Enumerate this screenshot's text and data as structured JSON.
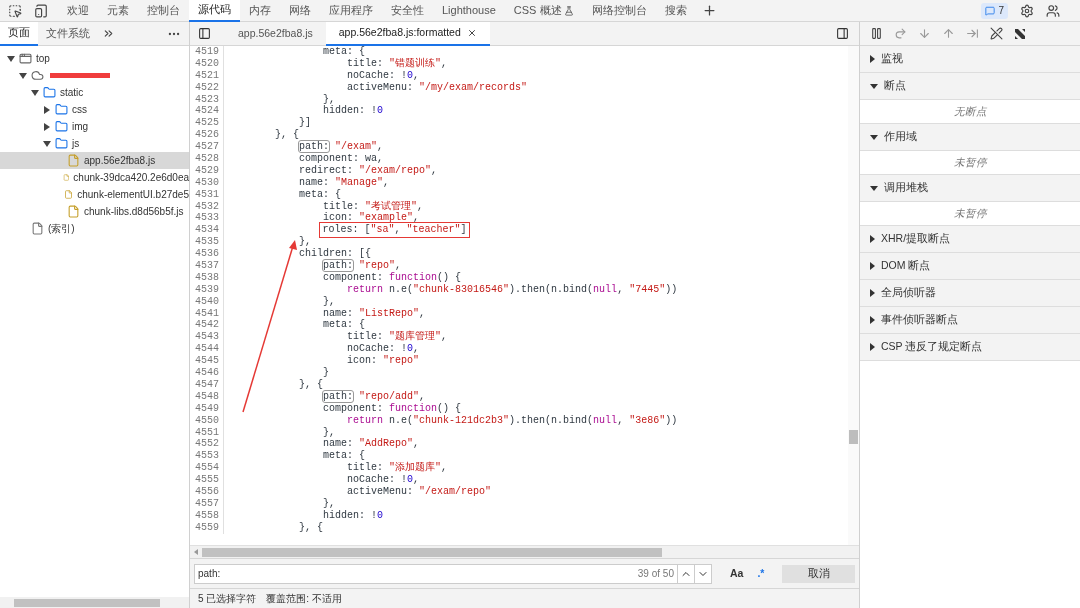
{
  "main_tabs": [
    {
      "label": "欢迎",
      "selected": false
    },
    {
      "label": "元素",
      "selected": false
    },
    {
      "label": "控制台",
      "selected": false
    },
    {
      "label": "源代码",
      "selected": true
    },
    {
      "label": "内存",
      "selected": false
    },
    {
      "label": "网络",
      "selected": false
    },
    {
      "label": "应用程序",
      "selected": false
    },
    {
      "label": "安全性",
      "selected": false
    },
    {
      "label": "Lighthouse",
      "selected": false
    },
    {
      "label": "CSS 概述",
      "selected": false,
      "flask": true
    },
    {
      "label": "网络控制台",
      "selected": false
    },
    {
      "label": "搜索",
      "selected": false
    }
  ],
  "issues_badge": "7",
  "navigator": {
    "tabs": [
      {
        "label": "页面",
        "selected": true
      },
      {
        "label": "文件系统",
        "selected": false
      }
    ],
    "tree": [
      {
        "kind": "frame",
        "label": "top",
        "expanded": true,
        "children": [
          {
            "kind": "domain",
            "expanded": true,
            "children": [
              {
                "kind": "folder",
                "label": "static",
                "expanded": true,
                "children": [
                  {
                    "kind": "folder",
                    "label": "css",
                    "expanded": false
                  },
                  {
                    "kind": "folder",
                    "label": "img",
                    "expanded": false
                  },
                  {
                    "kind": "folder",
                    "label": "js",
                    "expanded": true,
                    "children": [
                      {
                        "kind": "file",
                        "label": "app.56e2fba8.js",
                        "selected": true
                      },
                      {
                        "kind": "file",
                        "label": "chunk-39dca420.2e6d0ea",
                        "selected": false
                      },
                      {
                        "kind": "file",
                        "label": "chunk-elementUI.b27de5",
                        "selected": false
                      },
                      {
                        "kind": "file",
                        "label": "chunk-libs.d8d56b5f.js",
                        "selected": false
                      }
                    ]
                  }
                ]
              }
            ]
          },
          {
            "kind": "index",
            "label": "(索引)"
          }
        ]
      }
    ]
  },
  "editor_tabs": [
    {
      "label": "app.56e2fba8.js",
      "selected": false,
      "closable": false
    },
    {
      "label": "app.56e2fba8.js:formatted",
      "selected": true,
      "closable": true
    }
  ],
  "code_lines": [
    {
      "number": "4519",
      "tokens": [
        {
          "kind": "plain",
          "text": "                meta: {"
        }
      ]
    },
    {
      "number": "4520",
      "tokens": [
        {
          "kind": "plain",
          "text": "                    title: "
        },
        {
          "kind": "string",
          "text": "\"错题训练\""
        },
        {
          "kind": "plain",
          "text": ","
        }
      ]
    },
    {
      "number": "4521",
      "tokens": [
        {
          "kind": "plain",
          "text": "                    noCache: !"
        },
        {
          "kind": "number",
          "text": "0"
        },
        {
          "kind": "plain",
          "text": ","
        }
      ]
    },
    {
      "number": "4522",
      "tokens": [
        {
          "kind": "plain",
          "text": "                    activeMenu: "
        },
        {
          "kind": "string",
          "text": "\"/my/exam/records\""
        }
      ]
    },
    {
      "number": "4523",
      "tokens": [
        {
          "kind": "plain",
          "text": "                },"
        }
      ]
    },
    {
      "number": "4524",
      "tokens": [
        {
          "kind": "plain",
          "text": "                hidden: !"
        },
        {
          "kind": "number",
          "text": "0"
        }
      ]
    },
    {
      "number": "4525",
      "tokens": [
        {
          "kind": "plain",
          "text": "            }]"
        }
      ]
    },
    {
      "number": "4526",
      "tokens": [
        {
          "kind": "plain",
          "text": "        }, {"
        }
      ]
    },
    {
      "number": "4527",
      "tokens": [
        {
          "kind": "match",
          "text": "            path: "
        },
        {
          "kind": "string",
          "text": "\"/exam\""
        },
        {
          "kind": "plain",
          "text": ","
        }
      ]
    },
    {
      "number": "4528",
      "tokens": [
        {
          "kind": "plain",
          "text": "            component: wa,"
        }
      ]
    },
    {
      "number": "4529",
      "tokens": [
        {
          "kind": "plain",
          "text": "            redirect: "
        },
        {
          "kind": "string",
          "text": "\"/exam/repo\""
        },
        {
          "kind": "plain",
          "text": ","
        }
      ]
    },
    {
      "number": "4530",
      "tokens": [
        {
          "kind": "plain",
          "text": "            name: "
        },
        {
          "kind": "string",
          "text": "\"Manage\""
        },
        {
          "kind": "plain",
          "text": ","
        }
      ]
    },
    {
      "number": "4531",
      "tokens": [
        {
          "kind": "plain",
          "text": "            meta: {"
        }
      ]
    },
    {
      "number": "4532",
      "tokens": [
        {
          "kind": "plain",
          "text": "                title: "
        },
        {
          "kind": "string",
          "text": "\"考试管理\""
        },
        {
          "kind": "plain",
          "text": ","
        }
      ]
    },
    {
      "number": "4533",
      "tokens": [
        {
          "kind": "plain",
          "text": "                icon: "
        },
        {
          "kind": "string",
          "text": "\"example\""
        },
        {
          "kind": "plain",
          "text": ","
        }
      ]
    },
    {
      "number": "4534",
      "annotated": true,
      "tokens": [
        {
          "kind": "plain",
          "text": "                roles: ["
        },
        {
          "kind": "string",
          "text": "\"sa\""
        },
        {
          "kind": "plain",
          "text": ", "
        },
        {
          "kind": "string",
          "text": "\"teacher\""
        },
        {
          "kind": "plain",
          "text": "]"
        }
      ]
    },
    {
      "number": "4535",
      "tokens": [
        {
          "kind": "plain",
          "text": "            },"
        }
      ]
    },
    {
      "number": "4536",
      "tokens": [
        {
          "kind": "plain",
          "text": "            children: [{"
        }
      ]
    },
    {
      "number": "4537",
      "tokens": [
        {
          "kind": "match",
          "text": "                path: "
        },
        {
          "kind": "string",
          "text": "\"repo\""
        },
        {
          "kind": "plain",
          "text": ","
        }
      ]
    },
    {
      "number": "4538",
      "tokens": [
        {
          "kind": "plain",
          "text": "                component: "
        },
        {
          "kind": "keyword",
          "text": "function"
        },
        {
          "kind": "plain",
          "text": "() {"
        }
      ]
    },
    {
      "number": "4539",
      "tokens": [
        {
          "kind": "keyword",
          "text": "                    return"
        },
        {
          "kind": "plain",
          "text": " n.e("
        },
        {
          "kind": "string",
          "text": "\"chunk-83016546\""
        },
        {
          "kind": "plain",
          "text": ").then(n.bind("
        },
        {
          "kind": "keyword",
          "text": "null"
        },
        {
          "kind": "plain",
          "text": ", "
        },
        {
          "kind": "string",
          "text": "\"7445\""
        },
        {
          "kind": "plain",
          "text": "))"
        }
      ]
    },
    {
      "number": "4540",
      "tokens": [
        {
          "kind": "plain",
          "text": "                },"
        }
      ]
    },
    {
      "number": "4541",
      "tokens": [
        {
          "kind": "plain",
          "text": "                name: "
        },
        {
          "kind": "string",
          "text": "\"ListRepo\""
        },
        {
          "kind": "plain",
          "text": ","
        }
      ]
    },
    {
      "number": "4542",
      "tokens": [
        {
          "kind": "plain",
          "text": "                meta: {"
        }
      ]
    },
    {
      "number": "4543",
      "tokens": [
        {
          "kind": "plain",
          "text": "                    title: "
        },
        {
          "kind": "string",
          "text": "\"题库管理\""
        },
        {
          "kind": "plain",
          "text": ","
        }
      ]
    },
    {
      "number": "4544",
      "tokens": [
        {
          "kind": "plain",
          "text": "                    noCache: !"
        },
        {
          "kind": "number",
          "text": "0"
        },
        {
          "kind": "plain",
          "text": ","
        }
      ]
    },
    {
      "number": "4545",
      "tokens": [
        {
          "kind": "plain",
          "text": "                    icon: "
        },
        {
          "kind": "string",
          "text": "\"repo\""
        }
      ]
    },
    {
      "number": "4546",
      "tokens": [
        {
          "kind": "plain",
          "text": "                }"
        }
      ]
    },
    {
      "number": "4547",
      "tokens": [
        {
          "kind": "plain",
          "text": "            }, {"
        }
      ]
    },
    {
      "number": "4548",
      "tokens": [
        {
          "kind": "match",
          "text": "                path: "
        },
        {
          "kind": "string",
          "text": "\"repo/add\""
        },
        {
          "kind": "plain",
          "text": ","
        }
      ]
    },
    {
      "number": "4549",
      "tokens": [
        {
          "kind": "plain",
          "text": "                component: "
        },
        {
          "kind": "keyword",
          "text": "function"
        },
        {
          "kind": "plain",
          "text": "() {"
        }
      ]
    },
    {
      "number": "4550",
      "tokens": [
        {
          "kind": "keyword",
          "text": "                    return"
        },
        {
          "kind": "plain",
          "text": " n.e("
        },
        {
          "kind": "string",
          "text": "\"chunk-121dc2b3\""
        },
        {
          "kind": "plain",
          "text": ").then(n.bind("
        },
        {
          "kind": "keyword",
          "text": "null"
        },
        {
          "kind": "plain",
          "text": ", "
        },
        {
          "kind": "string",
          "text": "\"3e86\""
        },
        {
          "kind": "plain",
          "text": "))"
        }
      ]
    },
    {
      "number": "4551",
      "tokens": [
        {
          "kind": "plain",
          "text": "                },"
        }
      ]
    },
    {
      "number": "4552",
      "tokens": [
        {
          "kind": "plain",
          "text": "                name: "
        },
        {
          "kind": "string",
          "text": "\"AddRepo\""
        },
        {
          "kind": "plain",
          "text": ","
        }
      ]
    },
    {
      "number": "4553",
      "tokens": [
        {
          "kind": "plain",
          "text": "                meta: {"
        }
      ]
    },
    {
      "number": "4554",
      "tokens": [
        {
          "kind": "plain",
          "text": "                    title: "
        },
        {
          "kind": "string",
          "text": "\"添加题库\""
        },
        {
          "kind": "plain",
          "text": ","
        }
      ]
    },
    {
      "number": "4555",
      "tokens": [
        {
          "kind": "plain",
          "text": "                    noCache: !"
        },
        {
          "kind": "number",
          "text": "0"
        },
        {
          "kind": "plain",
          "text": ","
        }
      ]
    },
    {
      "number": "4556",
      "tokens": [
        {
          "kind": "plain",
          "text": "                    activeMenu: "
        },
        {
          "kind": "string",
          "text": "\"/exam/repo\""
        }
      ]
    },
    {
      "number": "4557",
      "tokens": [
        {
          "kind": "plain",
          "text": "                },"
        }
      ]
    },
    {
      "number": "4558",
      "tokens": [
        {
          "kind": "plain",
          "text": "                hidden: !"
        },
        {
          "kind": "number",
          "text": "0"
        }
      ]
    },
    {
      "number": "4559",
      "tokens": [
        {
          "kind": "plain",
          "text": "            }, {"
        }
      ]
    }
  ],
  "search": {
    "value": "path:",
    "count": "39 of 50",
    "match_case": "Aa",
    "regex": ".*",
    "cancel": "取消"
  },
  "status": [
    "5 已选择字符",
    "覆盖范围: 不适用"
  ],
  "debugger_sections": [
    {
      "label": "监视",
      "expanded": false
    },
    {
      "label": "断点",
      "expanded": true,
      "empty_text": "无断点"
    },
    {
      "label": "作用域",
      "expanded": true,
      "empty_text": "未暂停"
    },
    {
      "label": "调用堆栈",
      "expanded": true,
      "empty_text": "未暂停"
    },
    {
      "label": "XHR/提取断点",
      "expanded": false
    },
    {
      "label": "DOM 断点",
      "expanded": false
    },
    {
      "label": "全局侦听器",
      "expanded": false
    },
    {
      "label": "事件侦听器断点",
      "expanded": false
    },
    {
      "label": "CSP 违反了规定断点",
      "expanded": false
    }
  ]
}
